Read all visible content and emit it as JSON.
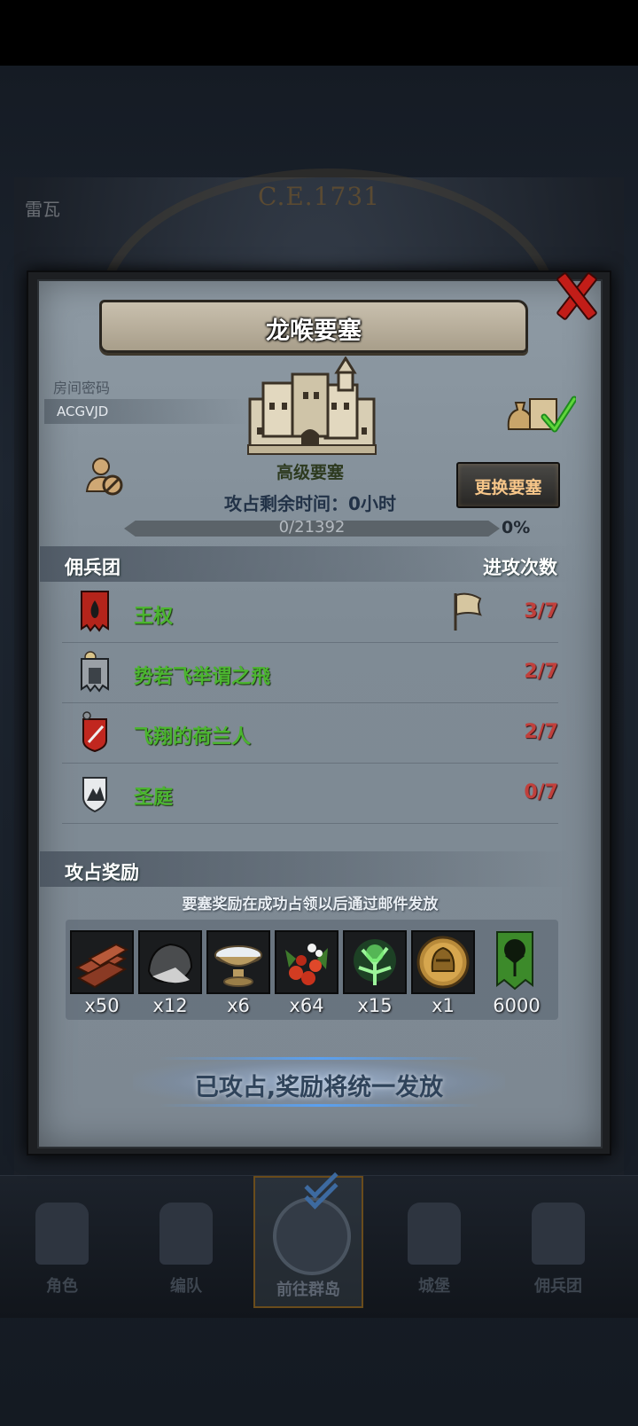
{
  "background": {
    "year_label": "C.E.1731",
    "city_label": "雷瓦"
  },
  "modal": {
    "title": "龙喉要塞",
    "room_password_label": "房间密码",
    "room_code": "ACGVJD",
    "fortress_type": "高级要塞",
    "time_remaining": "攻占剩余时间：0小时",
    "change_button": "更换要塞",
    "progress": {
      "text": "0/21392",
      "percent_label": "0%",
      "fraction": 0.0
    },
    "mercenary_section": {
      "title": "佣兵团",
      "attack_count_header": "进攻次数",
      "rows": [
        {
          "name": "王权",
          "count": "3/7",
          "emblem": "red-flame-banner-icon",
          "flag": true
        },
        {
          "name": "势若飞举谓之飛",
          "count": "2/7",
          "emblem": "grey-tower-banner-icon",
          "flag": false
        },
        {
          "name": "飞翔的荷兰人",
          "count": "2/7",
          "emblem": "red-shield-sword-icon",
          "flag": false
        },
        {
          "name": "圣庭",
          "count": "0/7",
          "emblem": "white-mountain-shield-icon",
          "flag": false
        }
      ]
    },
    "reward_section": {
      "title": "攻占奖励",
      "note": "要塞奖励在成功占领以后通过邮件发放",
      "items": [
        {
          "icon": "wood-logs-icon",
          "qty": "x50"
        },
        {
          "icon": "stone-icon",
          "qty": "x12"
        },
        {
          "icon": "salt-bowl-icon",
          "qty": "x6"
        },
        {
          "icon": "berries-icon",
          "qty": "x64"
        },
        {
          "icon": "green-crystal-tree-icon",
          "qty": "x15"
        },
        {
          "icon": "gold-helmet-medal-icon",
          "qty": "x1"
        },
        {
          "icon": "green-tree-banner-icon",
          "qty": "6000"
        }
      ]
    },
    "claim_status": "已攻占,奖励将统一发放"
  },
  "bottom_nav": {
    "items": [
      {
        "label": "角色"
      },
      {
        "label": "编队"
      },
      {
        "label": "前往群岛"
      },
      {
        "label": "城堡"
      },
      {
        "label": "佣兵团"
      }
    ]
  },
  "colors": {
    "merc_name": "#4bb52f",
    "attack_count": "#c0403c",
    "close_red": "#c21d18",
    "change_button_text": "#f7c689"
  }
}
